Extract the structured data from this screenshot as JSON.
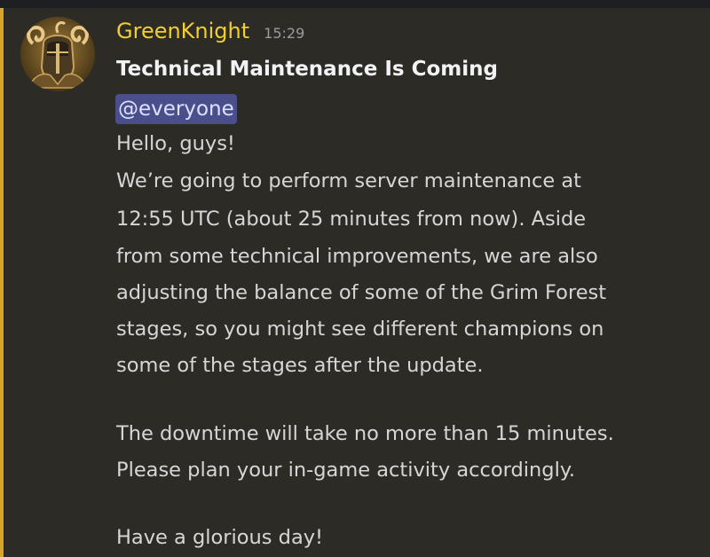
{
  "message": {
    "author": "GreenKnight",
    "timestamp": "15:29",
    "avatar_icon": "knight-helmet-avatar",
    "title": "Technical Maintenance Is Coming",
    "mention": "@everyone",
    "lines": [
      "Hello, guys!",
      "We’re going to perform server maintenance at",
      "12:55 UTC (about 25 minutes from now). Aside",
      "from some technical improvements, we are also",
      "adjusting the balance of some of the Grim Forest",
      "stages, so you might see different champions on",
      "some of the stages after the update.",
      "The downtime will take no more than 15 minutes.",
      "Please plan your in-game activity accordingly.",
      "Have a glorious day!"
    ]
  },
  "colors": {
    "background": "#2d2b26",
    "mention_stripe": "#d8a52a",
    "username": "#f0cf2e",
    "mention_bg": "#4a4f8c",
    "text": "#d6d6d6"
  }
}
